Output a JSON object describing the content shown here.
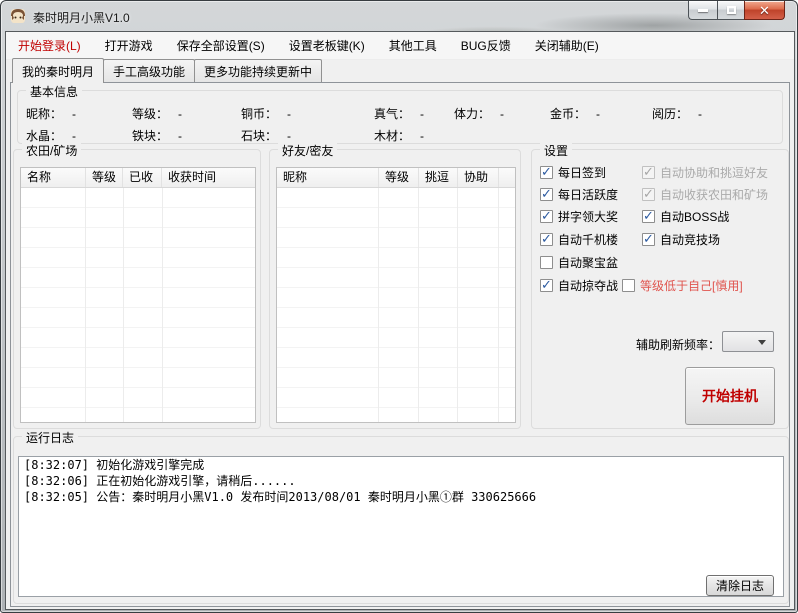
{
  "window": {
    "title": "秦时明月小黑V1.0"
  },
  "colors": {
    "menu_accent_red": "#c00000",
    "danger_red": "#e0544e",
    "check_blue": "#2c5aa0",
    "close_button_red": "#c94530"
  },
  "menu": {
    "items": [
      {
        "label": "开始登录(L)"
      },
      {
        "label": "打开游戏"
      },
      {
        "label": "保存全部设置(S)"
      },
      {
        "label": "设置老板键(K)"
      },
      {
        "label": "其他工具"
      },
      {
        "label": "BUG反馈"
      },
      {
        "label": "关闭辅助(E)"
      }
    ]
  },
  "tabs": [
    {
      "label": "我的秦时明月",
      "active": true
    },
    {
      "label": "手工高级功能",
      "active": false
    },
    {
      "label": "更多功能持续更新中",
      "active": false
    }
  ],
  "basic_info": {
    "title": "基本信息",
    "row1": [
      {
        "label": "昵称：",
        "value": "-"
      },
      {
        "label": "等级：",
        "value": "-"
      },
      {
        "label": "铜币：",
        "value": "-"
      },
      {
        "label": "真气：",
        "value": "-"
      },
      {
        "label": "体力：",
        "value": "-"
      },
      {
        "label": "金币：",
        "value": "-"
      },
      {
        "label": "阅历：",
        "value": "-"
      }
    ],
    "row2": [
      {
        "label": "水晶：",
        "value": "-"
      },
      {
        "label": "铁块：",
        "value": "-"
      },
      {
        "label": "石块：",
        "value": "-"
      },
      {
        "label": "木材：",
        "value": "-"
      }
    ]
  },
  "farm_table": {
    "title": "农田/矿场",
    "columns": [
      "名称",
      "等级",
      "已收",
      "收获时间"
    ],
    "rows": []
  },
  "friends_table": {
    "title": "好友/密友",
    "columns": [
      "昵称",
      "等级",
      "挑逗",
      "协助"
    ],
    "rows": []
  },
  "settings": {
    "title": "设置",
    "checkboxes": [
      {
        "label": "每日签到",
        "state": "on"
      },
      {
        "label": "自动协助和挑逗好友",
        "state": "on-disabled"
      },
      {
        "label": "每日活跃度",
        "state": "on"
      },
      {
        "label": "自动收获农田和矿场",
        "state": "on-disabled"
      },
      {
        "label": "拼字领大奖",
        "state": "on"
      },
      {
        "label": "自动BOSS战",
        "state": "on"
      },
      {
        "label": "自动千机楼",
        "state": "on"
      },
      {
        "label": "自动竞技场",
        "state": "on"
      },
      {
        "label": "自动聚宝盆",
        "state": "off"
      },
      {
        "label": "自动掠夺战",
        "state": "on"
      },
      {
        "label": "等级低于自己[慎用]",
        "state": "off"
      }
    ],
    "refresh_rate_label": "辅助刷新频率：",
    "refresh_rate_value": "",
    "start_button": "开始挂机"
  },
  "log": {
    "title": "运行日志",
    "lines": [
      "[8:32:07] 初始化游戏引擎完成",
      "[8:32:06] 正在初始化游戏引擎，请稍后......",
      "[8:32:05] 公告：秦时明月小黑V1.0 发布时间2013/08/01 秦时明月小黑①群  330625666"
    ],
    "clear_button": "清除日志"
  }
}
